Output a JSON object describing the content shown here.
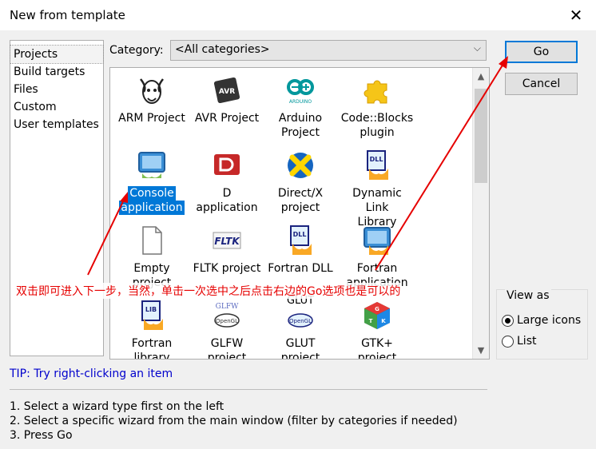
{
  "window": {
    "title": "New from template",
    "close_glyph": "✕"
  },
  "sidebar": {
    "items": [
      {
        "label": "Projects"
      },
      {
        "label": "Build targets"
      },
      {
        "label": "Files"
      },
      {
        "label": "Custom"
      },
      {
        "label": "User templates"
      }
    ],
    "selected": "Projects"
  },
  "category": {
    "label": "Category:",
    "value": "<All categories>"
  },
  "templates": [
    {
      "line1": "ARM Project",
      "line2": "",
      "icon": "gnu-icon"
    },
    {
      "line1": "AVR Project",
      "line2": "",
      "icon": "avr-chip-icon"
    },
    {
      "line1": "Arduino",
      "line2": "Project",
      "icon": "arduino-icon"
    },
    {
      "line1": "Code::Blocks",
      "line2": "plugin",
      "icon": "puzzle-icon"
    },
    {
      "line1": "Console",
      "line2": "application",
      "icon": "console-icon",
      "selected": true
    },
    {
      "line1": "D application",
      "line2": "",
      "icon": "d-lang-icon"
    },
    {
      "line1": "Direct/X",
      "line2": "project",
      "icon": "directx-icon"
    },
    {
      "line1": "Dynamic Link",
      "line2": "Library",
      "icon": "dll-icon"
    },
    {
      "line1": "Empty",
      "line2": "project",
      "icon": "blank-page-icon"
    },
    {
      "line1": "FLTK project",
      "line2": "",
      "icon": "fltk-icon"
    },
    {
      "line1": "Fortran DLL",
      "line2": "",
      "icon": "fortran-dll-icon"
    },
    {
      "line1": "Fortran",
      "line2": "application",
      "icon": "fortran-app-icon"
    },
    {
      "line1": "Fortran",
      "line2": "library",
      "icon": "lib-icon"
    },
    {
      "line1": "GLFW",
      "line2": "project",
      "icon": "glfw-icon"
    },
    {
      "line1": "GLUT",
      "line2": "project",
      "icon": "glut-icon"
    },
    {
      "line1": "GTK+",
      "line2": "project",
      "icon": "gtk-icon"
    }
  ],
  "buttons": {
    "go": "Go",
    "cancel": "Cancel"
  },
  "view_as": {
    "title": "View as",
    "options": [
      {
        "label": "Large icons",
        "checked": true
      },
      {
        "label": "List",
        "checked": false
      }
    ]
  },
  "tip": "TIP: Try right-clicking an item",
  "steps": [
    "1. Select a wizard type first on the left",
    "2. Select a specific wizard from the main window (filter by categories if needed)",
    "3. Press Go"
  ],
  "annotation": "双击即可进入下一步，当然，单击一次选中之后点击右边的Go选项也是可以的",
  "colors": {
    "selection": "#0078d7",
    "annotation_red": "#e60000",
    "tip_blue": "#0000cc"
  }
}
